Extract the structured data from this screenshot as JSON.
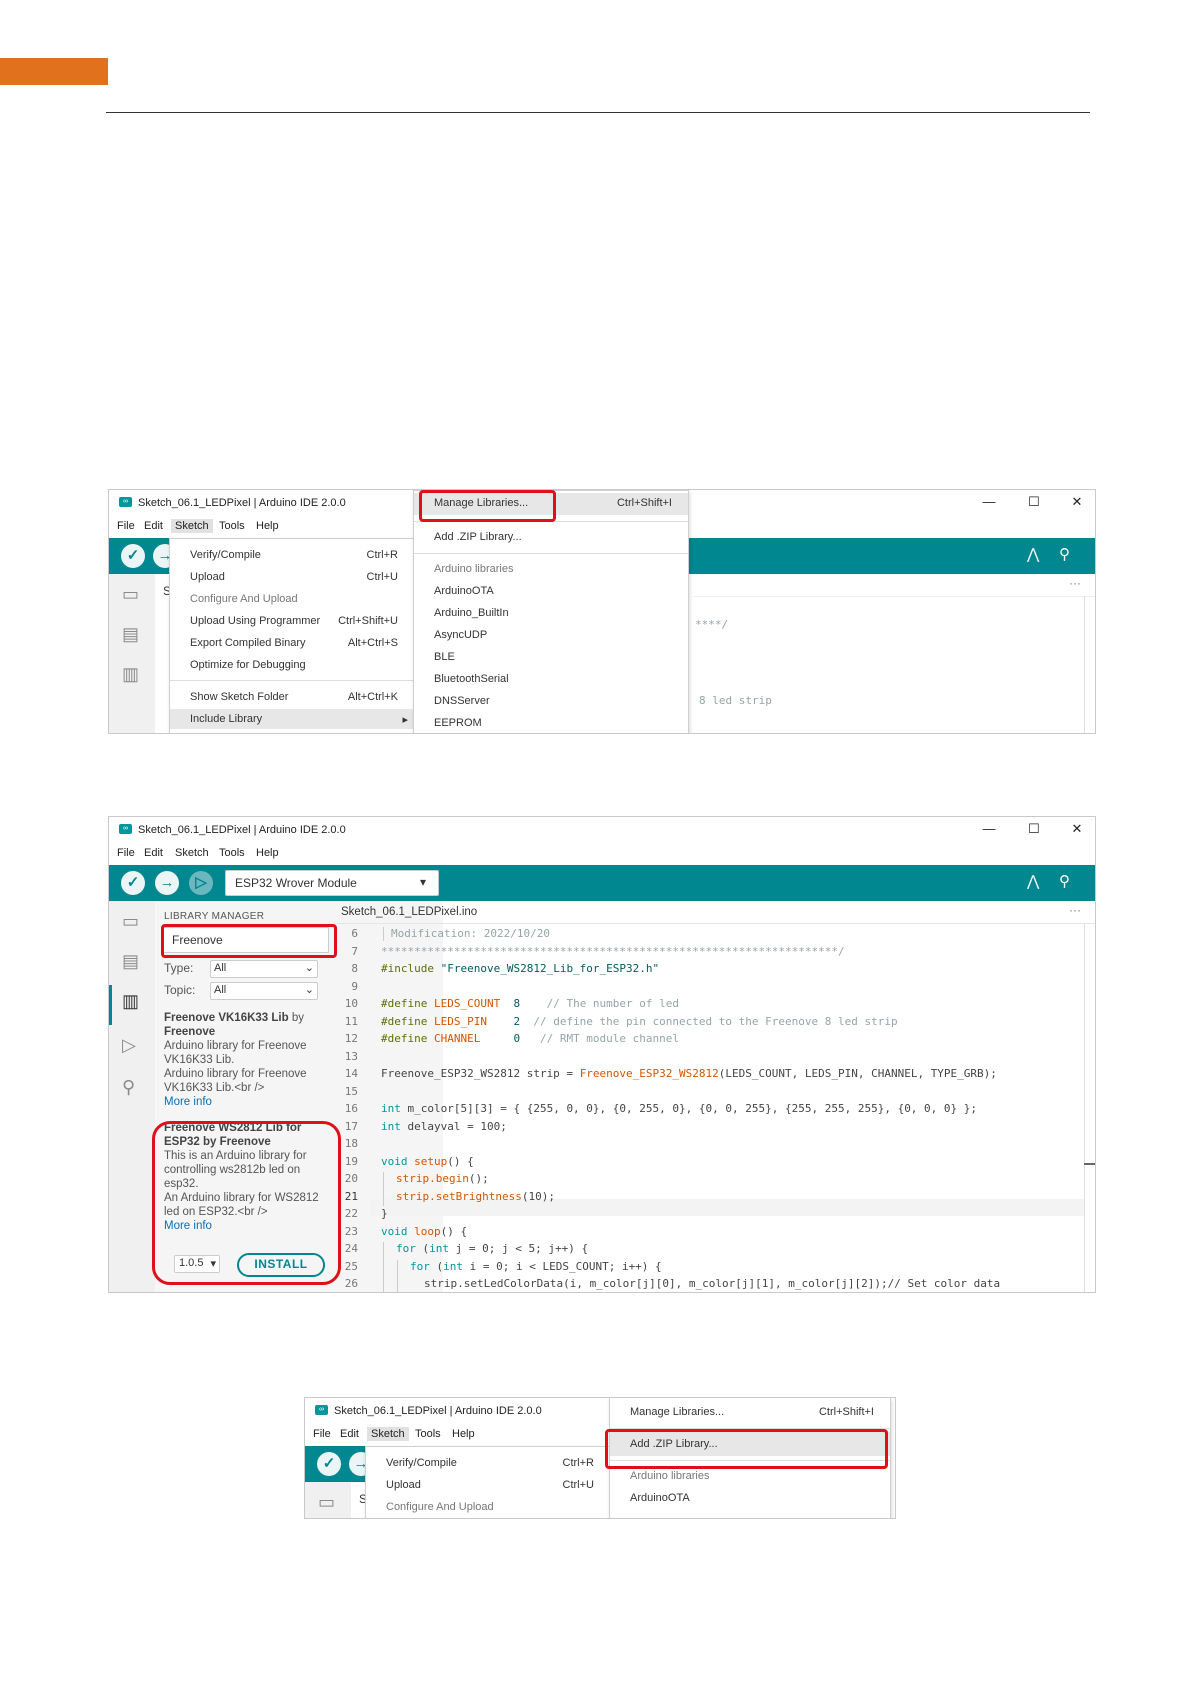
{
  "app_title": "Sketch_06.1_LEDPixel | Arduino IDE 2.0.0",
  "menubar": [
    "File",
    "Edit",
    "Sketch",
    "Tools",
    "Help"
  ],
  "shot1": {
    "sketch_menu": [
      {
        "label": "Verify/Compile",
        "shortcut": "Ctrl+R"
      },
      {
        "label": "Upload",
        "shortcut": "Ctrl+U"
      },
      {
        "label": "Configure And Upload",
        "shortcut": ""
      },
      {
        "label": "Upload Using Programmer",
        "shortcut": "Ctrl+Shift+U"
      },
      {
        "label": "Export Compiled Binary",
        "shortcut": "Alt+Ctrl+S"
      },
      {
        "label": "Optimize for Debugging",
        "shortcut": ""
      },
      {
        "label": "Show Sketch Folder",
        "shortcut": "Alt+Ctrl+K"
      },
      {
        "label": "Include Library",
        "shortcut": "▸"
      }
    ],
    "include_menu": {
      "manage": {
        "label": "Manage Libraries...",
        "shortcut": "Ctrl+Shift+I"
      },
      "add_zip": "Add .ZIP Library...",
      "section": "Arduino libraries",
      "items": [
        "ArduinoOTA",
        "Arduino_BuiltIn",
        "AsyncUDP",
        "BLE",
        "BluetoothSerial",
        "DNSServer",
        "EEPROM"
      ]
    },
    "partial_s": "S",
    "code_fragment_1": "****/",
    "code_fragment_2": "8 led strip"
  },
  "shot2": {
    "board": "ESP32 Wrover Module",
    "board_caret": "▾",
    "library_manager": {
      "title": "LIBRARY MANAGER",
      "search_value": "Freenove",
      "type_label": "Type:",
      "type_value": "All",
      "topic_label": "Topic:",
      "topic_value": "All",
      "lib1": {
        "name": "Freenove VK16K33 Lib",
        "by": "by",
        "author": "Freenove",
        "desc": [
          "Arduino library for Freenove",
          "VK16K33 Lib.",
          "Arduino library for Freenove",
          "VK16K33 Lib.<br />"
        ],
        "more": "More info"
      },
      "lib2": {
        "name": "Freenove WS2812 Lib for",
        "name2": "ESP32",
        "by": "by Freenove",
        "desc": [
          "This is an Arduino library for",
          "controlling ws2812b led on",
          "esp32.",
          "An Arduino library for WS2812",
          "led on ESP32.<br />"
        ],
        "more": "More info",
        "version": "1.0.5",
        "version_caret": "▾",
        "install": "INSTALL"
      }
    },
    "tab": "Sketch_06.1_LEDPixel.ino",
    "ellipsis": "···",
    "line_numbers": [
      "6",
      "7",
      "8",
      "9",
      "10",
      "11",
      "12",
      "13",
      "14",
      "15",
      "16",
      "17",
      "18",
      "19",
      "20",
      "21",
      "22",
      "23",
      "24",
      "25",
      "26"
    ],
    "code": {
      "l6": "Modification: 2022/10/20",
      "l7": "*********************************************************************/",
      "l8a": "#include ",
      "l8b": "\"Freenove_WS2812_Lib_for_ESP32.h\"",
      "l10a": "#define ",
      "l10b": "LEDS_COUNT",
      "l10c": "  8    ",
      "l10d": "// The number of led",
      "l11a": "#define ",
      "l11b": "LEDS_PIN",
      "l11c": "    2  ",
      "l11d": "// define the pin connected to the Freenove 8 led strip",
      "l12a": "#define ",
      "l12b": "CHANNEL",
      "l12c": "     0   ",
      "l12d": "// RMT module channel",
      "l14a": "Freenove_ESP32_WS2812 strip = ",
      "l14b": "Freenove_ESP32_WS2812",
      "l14c": "(LEDS_COUNT, LEDS_PIN, CHANNEL, TYPE_GRB);",
      "l16a": "int",
      "l16b": " m_color[5][3] = { {255, 0, 0}, {0, 255, 0}, {0, 0, 255}, {255, 255, 255}, {0, 0, 0} };",
      "l17a": "int",
      "l17b": " delayval = 100;",
      "l19a": "void",
      "l19b": " setup",
      "l19c": "() {",
      "l20a": "strip",
      "l20b": ".begin",
      "l20c": "();",
      "l21a": "strip",
      "l21b": ".setBrightness",
      "l21c": "(10);",
      "l22": "}",
      "l23a": "void",
      "l23b": " loop",
      "l23c": "() {",
      "l24a": "for",
      "l24b": " (",
      "l24c": "int",
      "l24d": " j = 0; j < 5; j++) {",
      "l25a": "for",
      "l25b": " (",
      "l25c": "int",
      "l25d": " i = 0; i < LEDS_COUNT; i++) {",
      "l26": "strip.setLedColorData(i, m_color[j][0], m_color[j][1], m_color[j][2]);// Set color data"
    }
  },
  "shot3": {
    "sketch_menu": [
      {
        "label": "Verify/Compile",
        "shortcut": "Ctrl+R"
      },
      {
        "label": "Upload",
        "shortcut": "Ctrl+U"
      },
      {
        "label": "Configure And Upload",
        "shortcut": ""
      }
    ],
    "include_menu": {
      "manage": {
        "label": "Manage Libraries...",
        "shortcut": "Ctrl+Shift+I"
      },
      "add_zip": "Add .ZIP Library...",
      "section": "Arduino libraries",
      "items": [
        "ArduinoOTA"
      ]
    },
    "partial_s": "S"
  },
  "window_controls": {
    "minimize": "—",
    "maximize": "☐",
    "close": "✕"
  },
  "logo_text": "∞",
  "colors": {
    "accent_orange": "#E2711D",
    "toolbar_teal": "#00878F",
    "highlight_red": "#E0101A"
  }
}
